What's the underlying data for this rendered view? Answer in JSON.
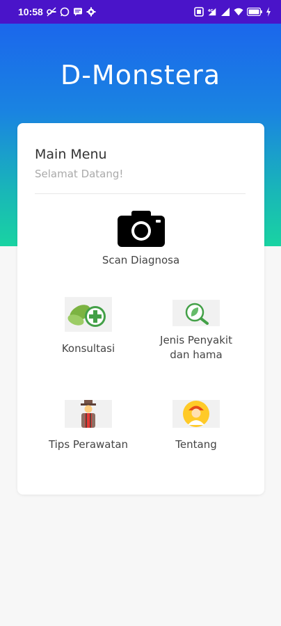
{
  "status_bar": {
    "time": "10:58",
    "left_icons": [
      "vpn-key-icon",
      "whatsapp-icon",
      "message-icon",
      "settings-icon"
    ],
    "right_icons": [
      "nfc-icon",
      "signal-4g-icon",
      "signal-bars-icon",
      "wifi-icon",
      "battery-icon",
      "charging-icon"
    ]
  },
  "header": {
    "app_title": "D-Monstera"
  },
  "menu": {
    "title": "Main Menu",
    "subtitle": "Selamat Datang!",
    "scan_label": "Scan Diagnosa",
    "items": [
      {
        "label": "Konsultasi",
        "icon": "leaf-plus-icon"
      },
      {
        "label": "Jenis Penyakit dan hama",
        "icon": "leaf-search-icon"
      },
      {
        "label": "Tips Perawatan",
        "icon": "farmer-icon"
      },
      {
        "label": "Tentang",
        "icon": "person-icon"
      }
    ]
  },
  "colors": {
    "status_bar": "#4a14c9",
    "header_top": "#1b67ec",
    "header_bottom": "#19d3a2",
    "leaf_green": "#4caf50"
  }
}
